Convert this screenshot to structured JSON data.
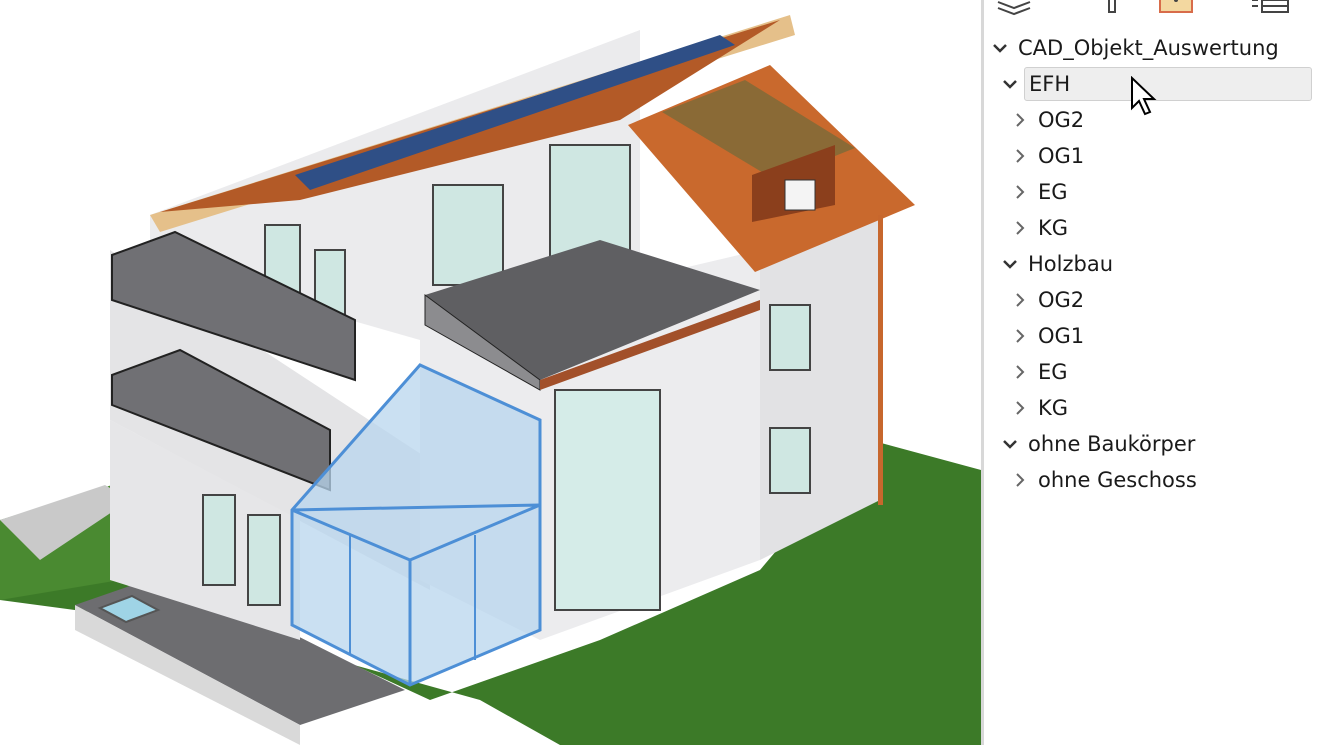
{
  "toolbar": {
    "icons": [
      "layers-icon",
      "pin-icon",
      "object-icon",
      "list-icon"
    ]
  },
  "tree": {
    "root": {
      "label": "CAD_Objekt_Auswertung",
      "expanded": true
    },
    "nodes": [
      {
        "label": "EFH",
        "expanded": true,
        "selected": true
      },
      {
        "label": "OG2",
        "expanded": false
      },
      {
        "label": "OG1",
        "expanded": false
      },
      {
        "label": "EG",
        "expanded": false
      },
      {
        "label": "KG",
        "expanded": false
      },
      {
        "label": "Holzbau",
        "expanded": true
      },
      {
        "label": "OG2",
        "expanded": false
      },
      {
        "label": "OG1",
        "expanded": false
      },
      {
        "label": "EG",
        "expanded": false
      },
      {
        "label": "KG",
        "expanded": false
      },
      {
        "label": "ohne Baukörper",
        "expanded": true
      },
      {
        "label": "ohne Geschoss",
        "expanded": false
      }
    ]
  },
  "colors": {
    "roof": "#b05a28",
    "fascia": "#e7c48c",
    "wall": "#e9e9eb",
    "grass": "#3f7d2a",
    "glass": "#5aa4e6",
    "selection": "#eeeeee"
  }
}
